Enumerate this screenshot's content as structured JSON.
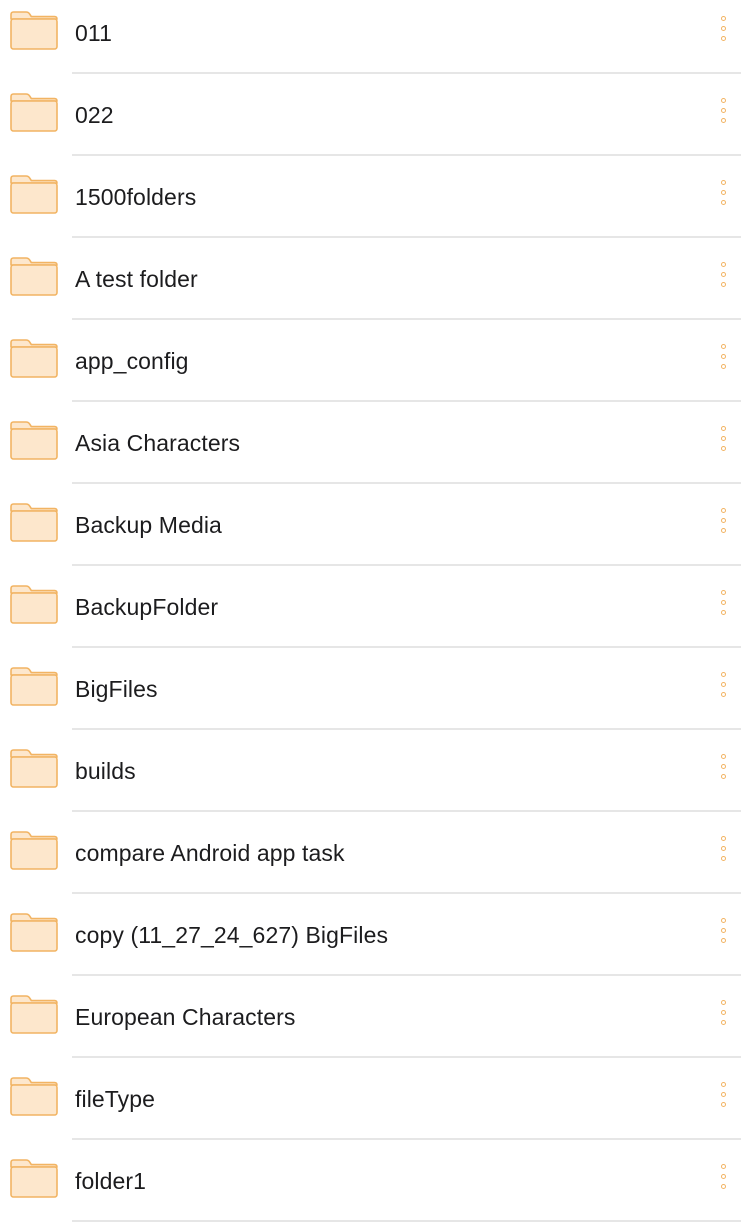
{
  "colors": {
    "folder_fill": "#fde7cc",
    "folder_stroke": "#f2b463",
    "more_dots": "#f2b463",
    "divider": "#e6e6e6",
    "text": "#1c1c1e"
  },
  "icons": {
    "folder": "folder-icon",
    "more": "more-vertical-icon"
  },
  "folders": [
    {
      "name": "011"
    },
    {
      "name": "022"
    },
    {
      "name": "1500folders"
    },
    {
      "name": "A test folder"
    },
    {
      "name": "app_config"
    },
    {
      "name": "Asia Characters"
    },
    {
      "name": "Backup Media"
    },
    {
      "name": "BackupFolder"
    },
    {
      "name": "BigFiles"
    },
    {
      "name": "builds"
    },
    {
      "name": "compare Android app task"
    },
    {
      "name": "copy (11_27_24_627) BigFiles"
    },
    {
      "name": "European Characters"
    },
    {
      "name": "fileType"
    },
    {
      "name": "folder1"
    }
  ]
}
